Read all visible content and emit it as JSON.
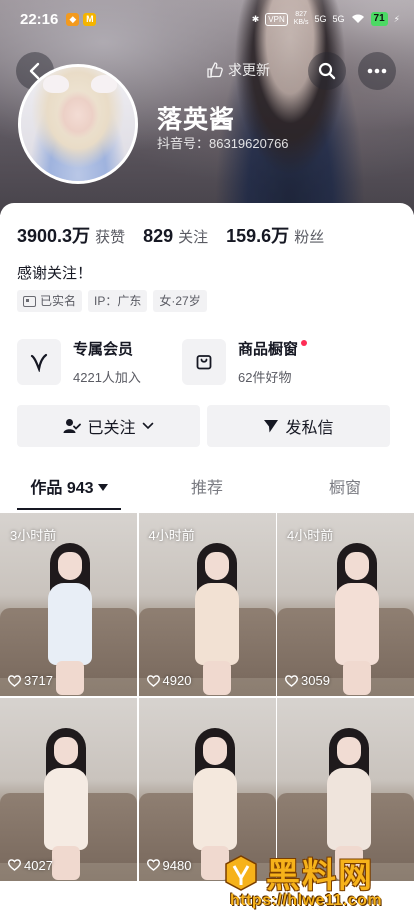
{
  "status_bar": {
    "time": "22:16",
    "app_badge_1": "",
    "app_badge_2": "M",
    "vpn": "VPN",
    "net_speed_top": "827",
    "net_speed_bottom": "KB/s",
    "signal_1": "5G",
    "signal_2": "5G",
    "battery": "71",
    "colors": {
      "app_badge_1": "#f39a1e",
      "app_badge_2": "#f4b400",
      "battery": "#4cd964"
    }
  },
  "nav": {
    "back_icon": "chevron-left-icon",
    "refresh_hint": "求更新",
    "search_icon": "search-icon",
    "more_icon": "more-dots-icon"
  },
  "profile": {
    "display_name": "落英酱",
    "user_id": "抖音号：86319620766",
    "bio": "感谢关注！",
    "stats": [
      {
        "value": "3900.3万",
        "label": "获赞"
      },
      {
        "value": "829",
        "label": "关注"
      },
      {
        "value": "159.6万",
        "label": "粉丝"
      }
    ],
    "tags": [
      {
        "icon": "id-card-icon",
        "text": "已实名"
      },
      {
        "text": "IP：广东"
      },
      {
        "text": "女·27岁"
      }
    ]
  },
  "features": {
    "vip": {
      "title": "专属会员",
      "subtitle": "4221人加入",
      "icon": "v-logo-icon"
    },
    "shop": {
      "title": "商品橱窗",
      "subtitle": "62件好物",
      "icon": "shopping-bag-icon",
      "badge_color": "#fe2c55"
    }
  },
  "actions": {
    "follow_label": "已关注",
    "message_label": "发私信"
  },
  "tabs": [
    {
      "label": "作品 943",
      "active": true
    },
    {
      "label": "推荐",
      "active": false
    },
    {
      "label": "橱窗",
      "active": false
    }
  ],
  "videos": [
    {
      "time": "3小时前",
      "likes": "3717",
      "outfit": "#e8eef6"
    },
    {
      "time": "4小时前",
      "likes": "4920",
      "outfit": "#f2e1d3"
    },
    {
      "time": "4小时前",
      "likes": "3059",
      "outfit": "#f3dfd6"
    },
    {
      "time": "",
      "likes": "4027",
      "outfit": "#f5ebe3"
    },
    {
      "time": "",
      "likes": "9480",
      "outfit": "#f4e8dd"
    },
    {
      "time": "",
      "likes": "",
      "outfit": "#efe4dc"
    }
  ],
  "watermark": {
    "title": "黑料网",
    "url": "https://hlwe11.com"
  }
}
